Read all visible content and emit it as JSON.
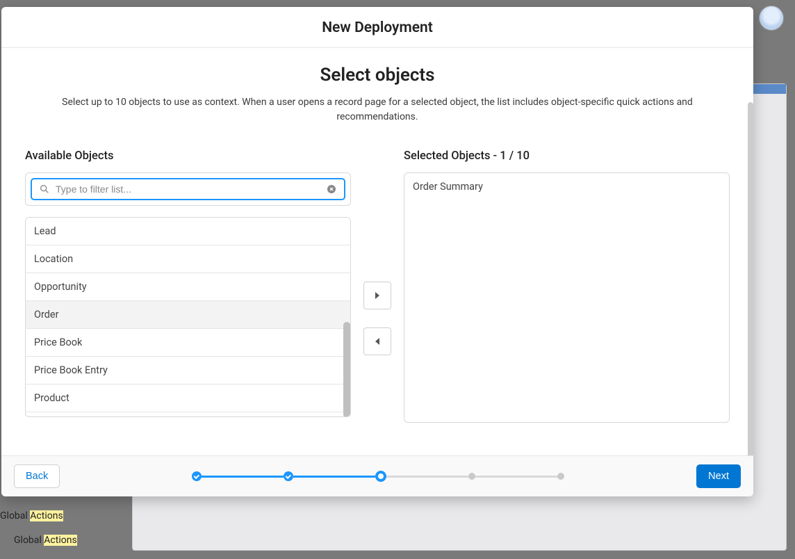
{
  "modal": {
    "title": "New Deployment",
    "section_title": "Select objects",
    "section_desc": "Select up to 10 objects to use as context. When a user opens a record page for a selected object, the list includes object-specific quick actions and recommendations."
  },
  "available": {
    "label": "Available Objects",
    "search_placeholder": "Type to filter list...",
    "items": [
      "Lead",
      "Location",
      "Opportunity",
      "Order",
      "Price Book",
      "Price Book Entry",
      "Product"
    ],
    "highlighted": "Order"
  },
  "selected": {
    "label": "Selected Objects - 1 / 10",
    "items": [
      "Order Summary"
    ]
  },
  "footer": {
    "back": "Back",
    "next": "Next"
  },
  "background": {
    "item1_prefix": "",
    "item2a": "Global ",
    "item2b": "Actions",
    "item3a": "Global ",
    "item3b": "Actions"
  }
}
